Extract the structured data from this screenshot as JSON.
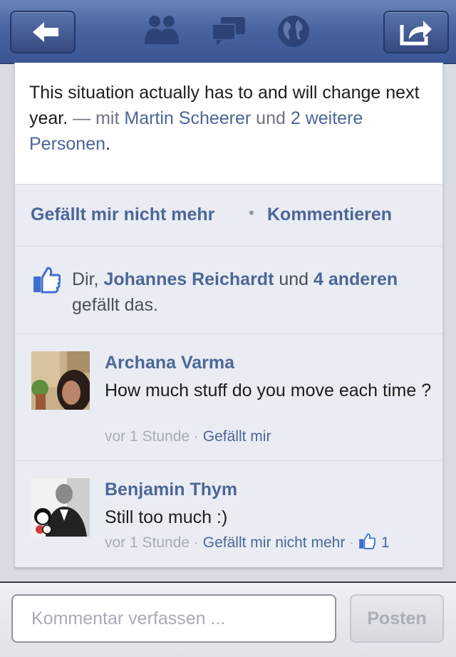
{
  "navbar": {
    "back_icon": "back-arrow-icon",
    "friends_icon": "friends-icon",
    "messages_icon": "messages-icon",
    "notifications_icon": "globe-icon",
    "share_icon": "share-icon",
    "bar_color": "#4a64a0"
  },
  "story": {
    "text": "This situation actually has to and will change next year.",
    "dash": " — mit ",
    "tag_person": "Martin Scheerer",
    "tag_and": " und ",
    "tag_others": "2 weitere Personen",
    "period": "."
  },
  "actions": {
    "unlike": "Gefällt mir nicht mehr",
    "separator": "•",
    "comment": "Kommentieren"
  },
  "likes": {
    "icon": "thumbs-up-icon",
    "prefix": "Dir, ",
    "person": "Johannes Reichardt",
    "and": " und ",
    "others": "4 anderen",
    "suffix": " gefällt das."
  },
  "comments": [
    {
      "name": "Archana Varma",
      "text": "How much stuff do you move each time ?",
      "time": "vor 1 Stunde",
      "sep": " · ",
      "action": "Gefällt mir"
    },
    {
      "name": "Benjamin Thym",
      "text": "Still too much :)",
      "time": "vor 1 Stunde",
      "sep": " · ",
      "action": "Gefällt mir nicht mehr",
      "sep2": " · ",
      "like_count": "1"
    }
  ],
  "composer": {
    "placeholder": "Kommentar verfassen ...",
    "post_label": "Posten"
  },
  "colors": {
    "link": "#4b6797",
    "background": "#e9ecf3"
  }
}
